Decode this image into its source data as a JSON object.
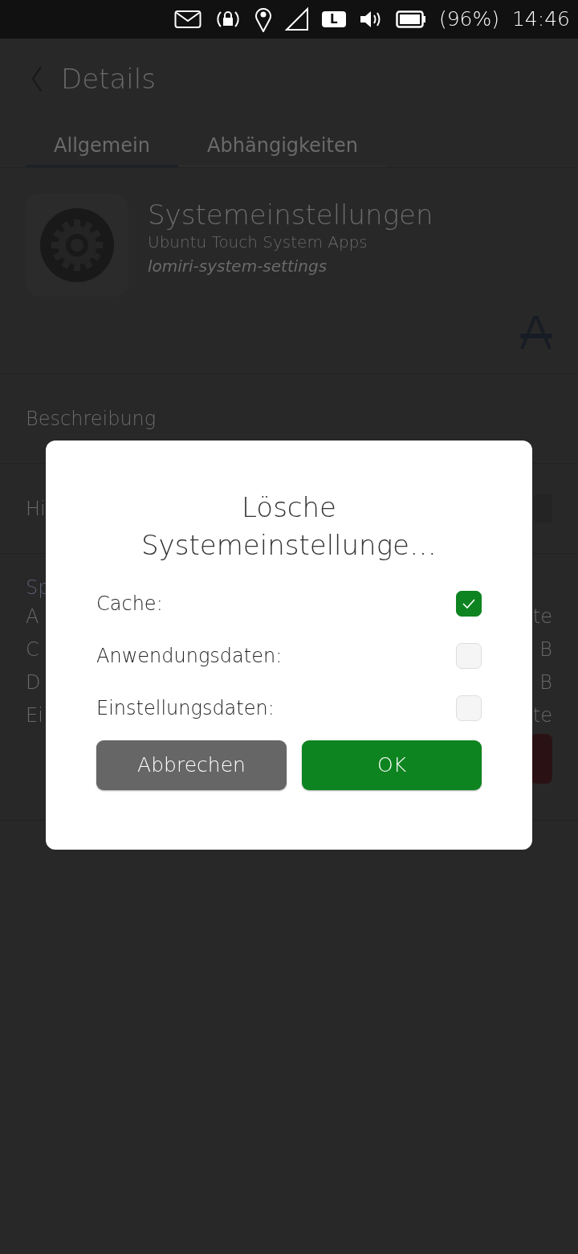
{
  "status_bar": {
    "network_badge": "L",
    "battery": "(96%)",
    "time": "14:46"
  },
  "header": {
    "title": "Details"
  },
  "tabs": [
    {
      "label": "Allgemein",
      "selected": true
    },
    {
      "label": "Abhängigkeiten",
      "selected": false
    }
  ],
  "app": {
    "name": "Systemeinstellungen",
    "publisher": "Ubuntu Touch System Apps",
    "package": "lomiri-system-settings"
  },
  "description": {
    "label": "Beschreibung"
  },
  "hidden_row": {
    "label": "Hi",
    "on": false
  },
  "storage": {
    "heading": "Sp",
    "rows": [
      {
        "label": "A",
        "value": "te"
      },
      {
        "label": "C",
        "value": "B"
      },
      {
        "label": "D",
        "value": "B"
      },
      {
        "label": "Ei",
        "value": "te"
      }
    ]
  },
  "dialog": {
    "title": "Lösche Systemeinstellunge…",
    "options": [
      {
        "label": "Cache:",
        "checked": true
      },
      {
        "label": "Anwendungsdaten:",
        "checked": false
      },
      {
        "label": "Einstellungsdaten:",
        "checked": false
      }
    ],
    "buttons": [
      {
        "label": "Abbrechen",
        "kind": "cancel"
      },
      {
        "label": "OK",
        "kind": "confirm"
      }
    ]
  }
}
